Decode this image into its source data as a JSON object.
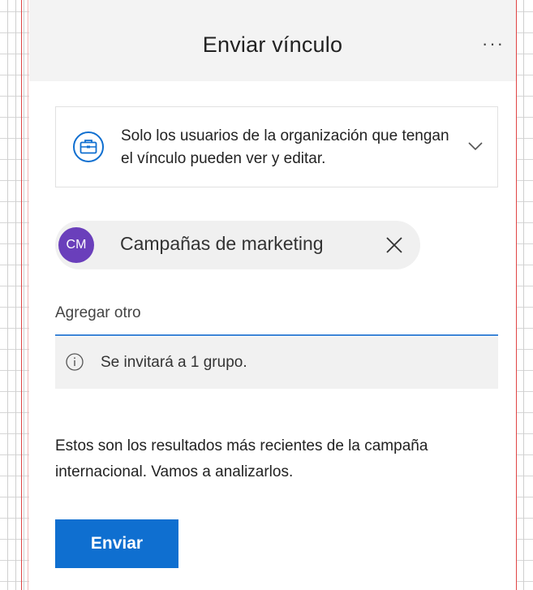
{
  "panel": {
    "title": "Enviar vínculo",
    "more_label": "···"
  },
  "permission": {
    "text": "Solo los usuarios de la organización que tengan el vínculo pueden ver y editar.",
    "icon": "briefcase-icon"
  },
  "recipients": [
    {
      "initials": "CM",
      "name": "Campañas de marketing",
      "avatar_color": "#6a3fbb"
    }
  ],
  "add_field": {
    "placeholder": "Agregar otro",
    "value": ""
  },
  "info": {
    "text": "Se invitará a 1 grupo."
  },
  "message": "Estos son los resultados más recientes de la campaña internacional. Vamos a analizarlos.",
  "send_button": "Enviar",
  "colors": {
    "accent": "#0f6fd0",
    "header_bg": "#f3f3f3",
    "avatar": "#6a3fbb"
  }
}
